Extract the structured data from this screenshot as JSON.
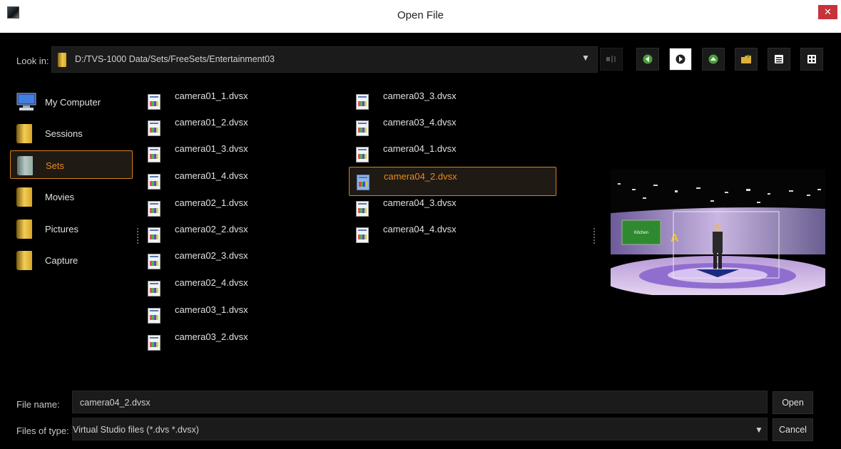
{
  "window": {
    "title": "Open File",
    "close_glyph": "✕"
  },
  "look_in": {
    "label": "Look in:",
    "path": "D:/TVS-1000 Data/Sets/FreeSets/Entertainment03",
    "dropdown_glyph": "▼"
  },
  "toolbar": {
    "buttons": [
      "volume-icon",
      "back-icon",
      "forward-icon",
      "up-icon",
      "new-folder-icon",
      "list-view-icon",
      "detail-view-icon"
    ]
  },
  "sidebar": {
    "items": [
      {
        "label": "My Computer",
        "icon": "computer-icon"
      },
      {
        "label": "Sessions",
        "icon": "folder-icon"
      },
      {
        "label": "Sets",
        "icon": "folder-icon",
        "selected": true
      },
      {
        "label": "Movies",
        "icon": "folder-icon"
      },
      {
        "label": "Pictures",
        "icon": "folder-icon"
      },
      {
        "label": "Capture",
        "icon": "folder-icon"
      }
    ]
  },
  "files": {
    "column1": [
      "camera01_1.dvsx",
      "camera01_2.dvsx",
      "camera01_3.dvsx",
      "camera01_4.dvsx",
      "camera02_1.dvsx",
      "camera02_2.dvsx",
      "camera02_3.dvsx",
      "camera02_4.dvsx",
      "camera03_1.dvsx",
      "camera03_2.dvsx"
    ],
    "column2": [
      "camera03_3.dvsx",
      "camera03_4.dvsx",
      "camera04_1.dvsx",
      "camera04_2.dvsx",
      "camera04_3.dvsx",
      "camera04_4.dvsx"
    ],
    "selected": "camera04_2.dvsx"
  },
  "preview": {
    "screen_text": "Kitchen",
    "logo_text": "A"
  },
  "file_name": {
    "label": "File name:",
    "value": "camera04_2.dvsx"
  },
  "file_type": {
    "label": "Files of type:",
    "value": "Virtual Studio files (*.dvs *.dvsx)",
    "dropdown_glyph": "▼"
  },
  "buttons": {
    "open": "Open",
    "cancel": "Cancel"
  },
  "colors": {
    "accent": "#d8811b",
    "selected_text": "#e88a1e",
    "background": "#000000",
    "field": "#1b1b1b"
  }
}
